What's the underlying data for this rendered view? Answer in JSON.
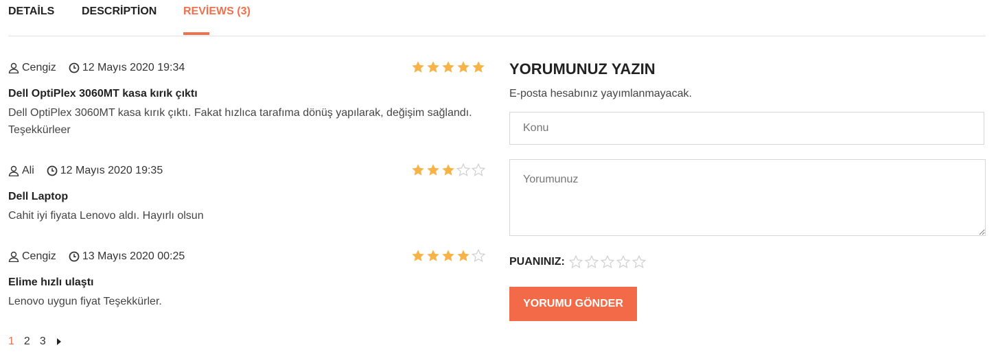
{
  "tabs": [
    {
      "label": "DETAİLS"
    },
    {
      "label": "DESCRİPTİON"
    },
    {
      "label": "REVİEWS (3)",
      "active": true
    }
  ],
  "reviews": [
    {
      "author": "Cengiz",
      "date": "12 Mayıs 2020 19:34",
      "rating": 5,
      "title": "Dell OptiPlex 3060MT kasa kırık çıktı",
      "text": "Dell OptiPlex 3060MT kasa kırık çıktı. Fakat hızlıca tarafıma dönüş yapılarak, değişim sağlandı. Teşekkürleer"
    },
    {
      "author": "Ali",
      "date": "12 Mayıs 2020 19:35",
      "rating": 3,
      "title": "Dell Laptop",
      "text": "Cahit iyi fiyata Lenovo aldı. Hayırlı olsun"
    },
    {
      "author": "Cengiz",
      "date": "13 Mayıs 2020 00:25",
      "rating": 4,
      "title": "Elime hızlı ulaştı",
      "text": "Lenovo uygun fiyat Teşekkürler."
    }
  ],
  "pagination": {
    "pages": [
      "1",
      "2",
      "3"
    ],
    "current": "1",
    "next_icon": "caret-right-icon"
  },
  "form": {
    "title": "YORUMUNUZ YAZIN",
    "note": "E-posta hesabınız yayımlanmayacak.",
    "subject_placeholder": "Konu",
    "comment_placeholder": "Yorumunuz",
    "rating_label": "PUANINIZ:",
    "rating_value": 0,
    "rating_max": 5,
    "submit_label": "YORUMU GÖNDER"
  },
  "colors": {
    "accent": "#f0704c",
    "star_filled": "#f7b347",
    "star_empty": "#cfcfcf"
  }
}
